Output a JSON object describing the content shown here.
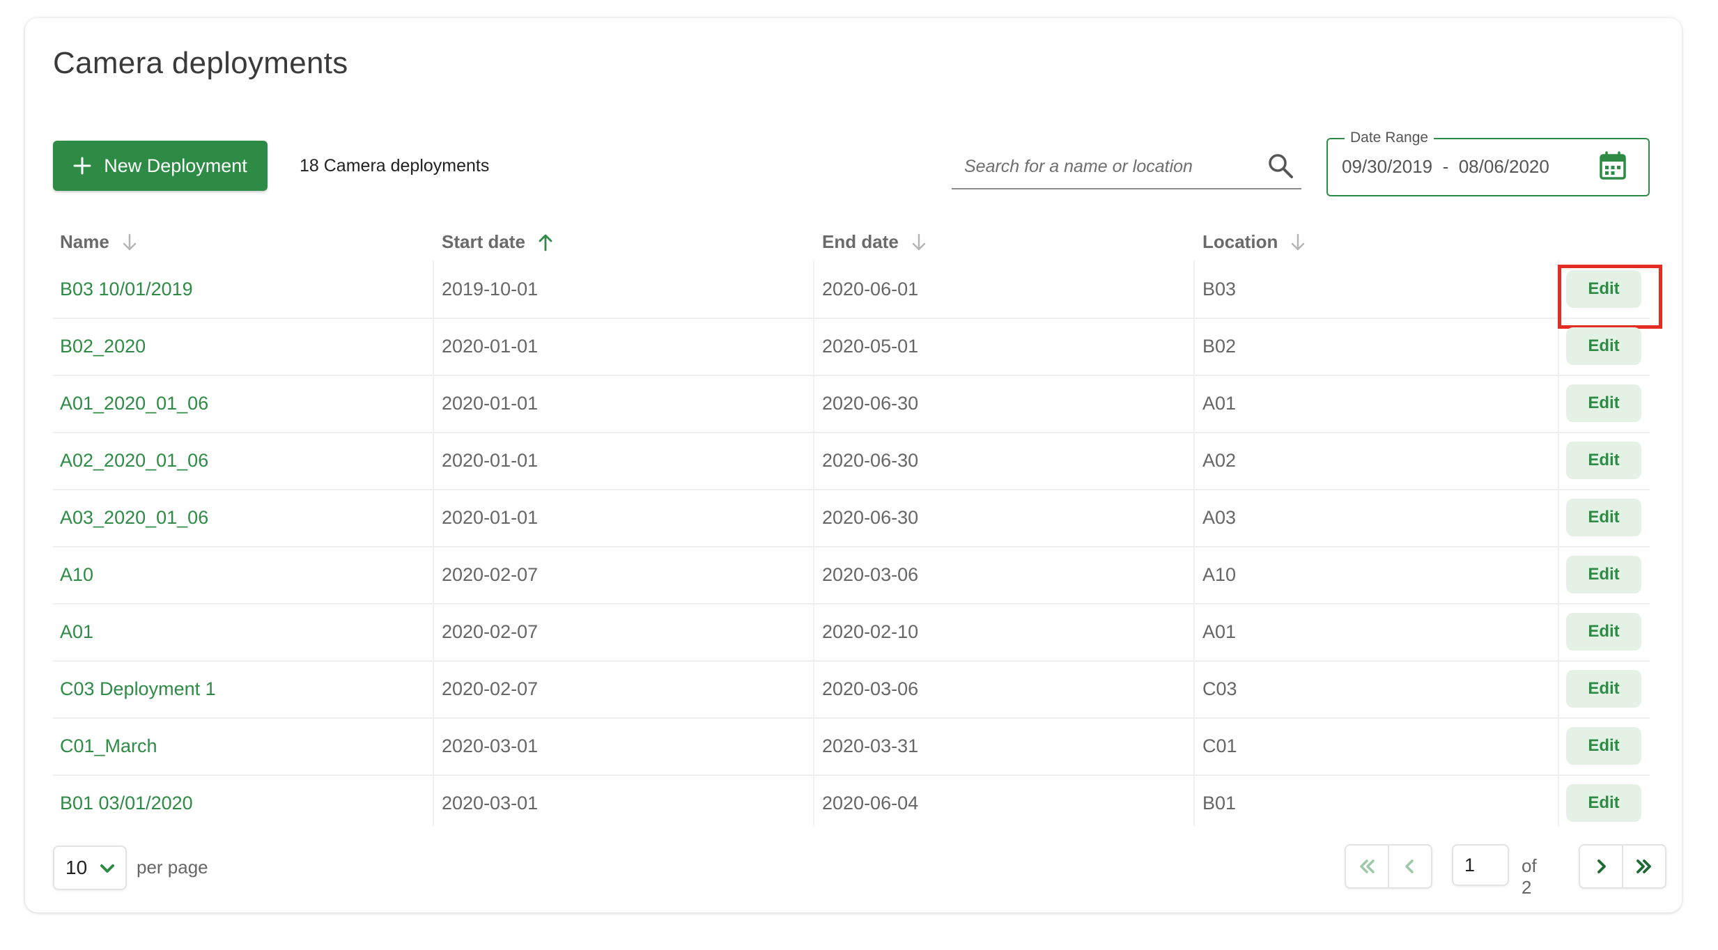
{
  "page": {
    "title": "Camera deployments"
  },
  "toolbar": {
    "new_button_label": "New Deployment",
    "count_text": "18 Camera deployments",
    "search_placeholder": "Search for a name or location",
    "date_range_label": "Date Range",
    "date_from": "09/30/2019",
    "date_to": "08/06/2020",
    "date_separator": "-"
  },
  "table": {
    "columns": [
      {
        "label": "Name",
        "sort": "down-inactive"
      },
      {
        "label": "Start date",
        "sort": "up-active"
      },
      {
        "label": "End date",
        "sort": "down-inactive"
      },
      {
        "label": "Location",
        "sort": "down-inactive"
      }
    ],
    "edit_label": "Edit",
    "rows": [
      {
        "name": "B03 10/01/2019",
        "start": "2019-10-01",
        "end": "2020-06-01",
        "location": "B03"
      },
      {
        "name": "B02_2020",
        "start": "2020-01-01",
        "end": "2020-05-01",
        "location": "B02"
      },
      {
        "name": "A01_2020_01_06",
        "start": "2020-01-01",
        "end": "2020-06-30",
        "location": "A01"
      },
      {
        "name": "A02_2020_01_06",
        "start": "2020-01-01",
        "end": "2020-06-30",
        "location": "A02"
      },
      {
        "name": "A03_2020_01_06",
        "start": "2020-01-01",
        "end": "2020-06-30",
        "location": "A03"
      },
      {
        "name": "A10",
        "start": "2020-02-07",
        "end": "2020-03-06",
        "location": "A10"
      },
      {
        "name": "A01",
        "start": "2020-02-07",
        "end": "2020-02-10",
        "location": "A01"
      },
      {
        "name": "C03 Deployment 1",
        "start": "2020-02-07",
        "end": "2020-03-06",
        "location": "C03"
      },
      {
        "name": "C01_March",
        "start": "2020-03-01",
        "end": "2020-03-31",
        "location": "C01"
      },
      {
        "name": "B01 03/01/2020",
        "start": "2020-03-01",
        "end": "2020-06-04",
        "location": "B01"
      }
    ]
  },
  "pagination": {
    "per_page_value": "10",
    "per_page_label": "per page",
    "current_page": "1",
    "of_text": "of 2"
  },
  "colors": {
    "accent": "#2e8b45",
    "edit_bg": "#e4f2e6",
    "highlight": "#e52c24"
  }
}
